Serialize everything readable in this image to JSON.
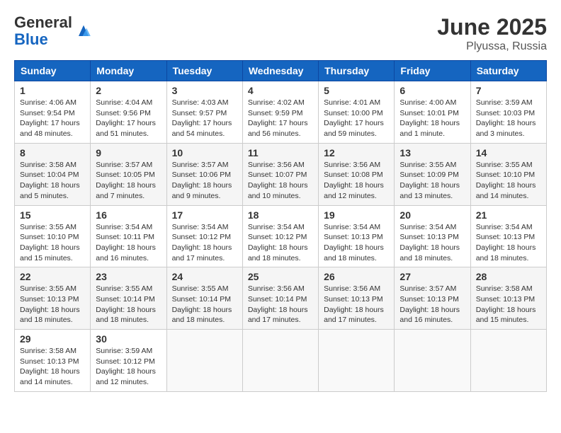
{
  "header": {
    "logo_general": "General",
    "logo_blue": "Blue",
    "month_year": "June 2025",
    "location": "Plyussa, Russia"
  },
  "weekdays": [
    "Sunday",
    "Monday",
    "Tuesday",
    "Wednesday",
    "Thursday",
    "Friday",
    "Saturday"
  ],
  "weeks": [
    [
      {
        "day": "1",
        "info": "Sunrise: 4:06 AM\nSunset: 9:54 PM\nDaylight: 17 hours\nand 48 minutes."
      },
      {
        "day": "2",
        "info": "Sunrise: 4:04 AM\nSunset: 9:56 PM\nDaylight: 17 hours\nand 51 minutes."
      },
      {
        "day": "3",
        "info": "Sunrise: 4:03 AM\nSunset: 9:57 PM\nDaylight: 17 hours\nand 54 minutes."
      },
      {
        "day": "4",
        "info": "Sunrise: 4:02 AM\nSunset: 9:59 PM\nDaylight: 17 hours\nand 56 minutes."
      },
      {
        "day": "5",
        "info": "Sunrise: 4:01 AM\nSunset: 10:00 PM\nDaylight: 17 hours\nand 59 minutes."
      },
      {
        "day": "6",
        "info": "Sunrise: 4:00 AM\nSunset: 10:01 PM\nDaylight: 18 hours\nand 1 minute."
      },
      {
        "day": "7",
        "info": "Sunrise: 3:59 AM\nSunset: 10:03 PM\nDaylight: 18 hours\nand 3 minutes."
      }
    ],
    [
      {
        "day": "8",
        "info": "Sunrise: 3:58 AM\nSunset: 10:04 PM\nDaylight: 18 hours\nand 5 minutes."
      },
      {
        "day": "9",
        "info": "Sunrise: 3:57 AM\nSunset: 10:05 PM\nDaylight: 18 hours\nand 7 minutes."
      },
      {
        "day": "10",
        "info": "Sunrise: 3:57 AM\nSunset: 10:06 PM\nDaylight: 18 hours\nand 9 minutes."
      },
      {
        "day": "11",
        "info": "Sunrise: 3:56 AM\nSunset: 10:07 PM\nDaylight: 18 hours\nand 10 minutes."
      },
      {
        "day": "12",
        "info": "Sunrise: 3:56 AM\nSunset: 10:08 PM\nDaylight: 18 hours\nand 12 minutes."
      },
      {
        "day": "13",
        "info": "Sunrise: 3:55 AM\nSunset: 10:09 PM\nDaylight: 18 hours\nand 13 minutes."
      },
      {
        "day": "14",
        "info": "Sunrise: 3:55 AM\nSunset: 10:10 PM\nDaylight: 18 hours\nand 14 minutes."
      }
    ],
    [
      {
        "day": "15",
        "info": "Sunrise: 3:55 AM\nSunset: 10:10 PM\nDaylight: 18 hours\nand 15 minutes."
      },
      {
        "day": "16",
        "info": "Sunrise: 3:54 AM\nSunset: 10:11 PM\nDaylight: 18 hours\nand 16 minutes."
      },
      {
        "day": "17",
        "info": "Sunrise: 3:54 AM\nSunset: 10:12 PM\nDaylight: 18 hours\nand 17 minutes."
      },
      {
        "day": "18",
        "info": "Sunrise: 3:54 AM\nSunset: 10:12 PM\nDaylight: 18 hours\nand 18 minutes."
      },
      {
        "day": "19",
        "info": "Sunrise: 3:54 AM\nSunset: 10:13 PM\nDaylight: 18 hours\nand 18 minutes."
      },
      {
        "day": "20",
        "info": "Sunrise: 3:54 AM\nSunset: 10:13 PM\nDaylight: 18 hours\nand 18 minutes."
      },
      {
        "day": "21",
        "info": "Sunrise: 3:54 AM\nSunset: 10:13 PM\nDaylight: 18 hours\nand 18 minutes."
      }
    ],
    [
      {
        "day": "22",
        "info": "Sunrise: 3:55 AM\nSunset: 10:13 PM\nDaylight: 18 hours\nand 18 minutes."
      },
      {
        "day": "23",
        "info": "Sunrise: 3:55 AM\nSunset: 10:14 PM\nDaylight: 18 hours\nand 18 minutes."
      },
      {
        "day": "24",
        "info": "Sunrise: 3:55 AM\nSunset: 10:14 PM\nDaylight: 18 hours\nand 18 minutes."
      },
      {
        "day": "25",
        "info": "Sunrise: 3:56 AM\nSunset: 10:14 PM\nDaylight: 18 hours\nand 17 minutes."
      },
      {
        "day": "26",
        "info": "Sunrise: 3:56 AM\nSunset: 10:13 PM\nDaylight: 18 hours\nand 17 minutes."
      },
      {
        "day": "27",
        "info": "Sunrise: 3:57 AM\nSunset: 10:13 PM\nDaylight: 18 hours\nand 16 minutes."
      },
      {
        "day": "28",
        "info": "Sunrise: 3:58 AM\nSunset: 10:13 PM\nDaylight: 18 hours\nand 15 minutes."
      }
    ],
    [
      {
        "day": "29",
        "info": "Sunrise: 3:58 AM\nSunset: 10:13 PM\nDaylight: 18 hours\nand 14 minutes."
      },
      {
        "day": "30",
        "info": "Sunrise: 3:59 AM\nSunset: 10:12 PM\nDaylight: 18 hours\nand 12 minutes."
      },
      {
        "day": "",
        "info": ""
      },
      {
        "day": "",
        "info": ""
      },
      {
        "day": "",
        "info": ""
      },
      {
        "day": "",
        "info": ""
      },
      {
        "day": "",
        "info": ""
      }
    ]
  ]
}
